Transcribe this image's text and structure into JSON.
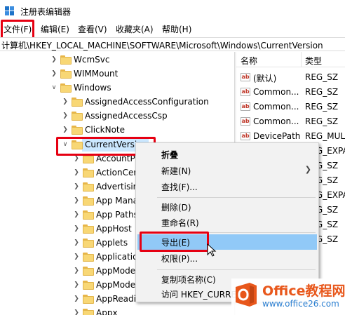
{
  "window": {
    "title": "注册表编辑器"
  },
  "menubar": {
    "items": [
      {
        "label": "文件(F)"
      },
      {
        "label": "编辑(E)"
      },
      {
        "label": "查看(V)"
      },
      {
        "label": "收藏夹(A)"
      },
      {
        "label": "帮助(H)"
      }
    ]
  },
  "address": {
    "path": "计算机\\HKEY_LOCAL_MACHINE\\SOFTWARE\\Microsoft\\Windows\\CurrentVersion"
  },
  "tree": {
    "items": [
      {
        "label": "WcmSvc",
        "expanded": false
      },
      {
        "label": "WIMMount",
        "expanded": false
      },
      {
        "label": "Windows",
        "expanded": true
      },
      {
        "label": "AssignedAccessConfiguration",
        "expanded": false
      },
      {
        "label": "AssignedAccessCsp",
        "expanded": false
      },
      {
        "label": "ClickNote",
        "expanded": false
      },
      {
        "label": "CurrentVersion",
        "expanded": true,
        "selected": true
      },
      {
        "label": "AccountPi",
        "expanded": false
      },
      {
        "label": "ActionCer",
        "expanded": false
      },
      {
        "label": "Advertisin",
        "expanded": false
      },
      {
        "label": "App Mana",
        "expanded": false
      },
      {
        "label": "App Paths",
        "expanded": false
      },
      {
        "label": "AppHost",
        "expanded": false
      },
      {
        "label": "Applets",
        "expanded": false
      },
      {
        "label": "Applicatio",
        "expanded": false
      },
      {
        "label": "AppMode",
        "expanded": false
      },
      {
        "label": "AppMode",
        "expanded": false
      },
      {
        "label": "AppReadi",
        "expanded": false
      },
      {
        "label": "Appx",
        "expanded": false
      }
    ]
  },
  "values": {
    "header": {
      "name": "名称",
      "type": "类型"
    },
    "rows": [
      {
        "name": "(默认)",
        "type": "REG_SZ"
      },
      {
        "name": "Common...",
        "type": "REG_SZ"
      },
      {
        "name": "Common...",
        "type": "REG_SZ"
      },
      {
        "name": "Common...",
        "type": "REG_SZ"
      },
      {
        "name": "DevicePath",
        "type": "REG_MUL"
      },
      {
        "name": "",
        "type": "REG_EXPA"
      },
      {
        "name": "",
        "type": "REG_SZ"
      },
      {
        "name": "",
        "type": "REG_SZ"
      },
      {
        "name": "",
        "type": "REG_EXPA"
      },
      {
        "name": "",
        "type": "REG_SZ"
      },
      {
        "name": "",
        "type": "REG_SZ"
      },
      {
        "name": "",
        "type": "REG_SZ"
      }
    ]
  },
  "context_menu": {
    "collapse": "折叠",
    "new": "新建(N)",
    "find": "查找(F)...",
    "delete": "删除(D)",
    "rename": "重命名(R)",
    "export": "导出(E)",
    "permissions": "权限(P)...",
    "copy_key_name": "复制项名称(C)",
    "goto": "访问 HKEY_CURRE"
  },
  "watermark": {
    "brand": "Office教程网",
    "url": "www.office26.com"
  },
  "colors": {
    "highlight": "#e60012",
    "selection": "#cce8ff",
    "menu_hover": "#91c9f7",
    "folder": "#f8d775"
  }
}
